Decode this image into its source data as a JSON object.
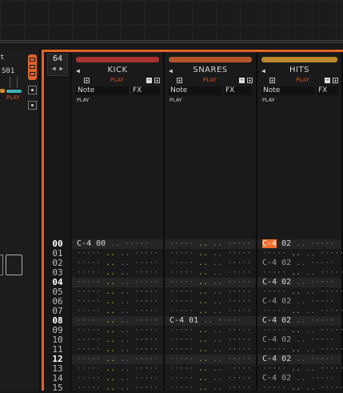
{
  "left_panel": {
    "title_fragment": "t",
    "sample_label": "S01",
    "play_label": "PLAY"
  },
  "pattern": {
    "length": "64",
    "row_numbers": [
      "00",
      "01",
      "02",
      "03",
      "04",
      "05",
      "06",
      "07",
      "08",
      "09",
      "10",
      "11",
      "12",
      "13",
      "14",
      "15"
    ]
  },
  "tracks": [
    {
      "name": "KICK",
      "color": "#a8322f",
      "play_label": "PLAY",
      "mode_label": "PLAY",
      "col_note": "Note",
      "col_fx": "FX",
      "notes": {
        "0": "C-4 00"
      }
    },
    {
      "name": "SNARES",
      "color": "#b2552b",
      "play_label": "PLAY",
      "mode_label": "PLAY",
      "col_note": "Note",
      "col_fx": "FX",
      "notes": {
        "8": "C-4 01"
      }
    },
    {
      "name": "HITS",
      "color": "#b98a2c",
      "play_label": "PLAY",
      "mode_label": "PLAY",
      "col_note": "Note",
      "col_fx": "FX",
      "notes": {
        "0": "C-4 02",
        "2": "C-4 02",
        "4": "C-4 02",
        "6": "C-4 02",
        "8": "C-4 02",
        "10": "C-4 02",
        "12": "C-4 02",
        "14": "C-4 02"
      }
    }
  ],
  "cursor": {
    "track": 2,
    "row": 0,
    "cell_text": "C-4"
  },
  "colors": {
    "accent": "#e0632a",
    "cursor": "#f07030"
  }
}
